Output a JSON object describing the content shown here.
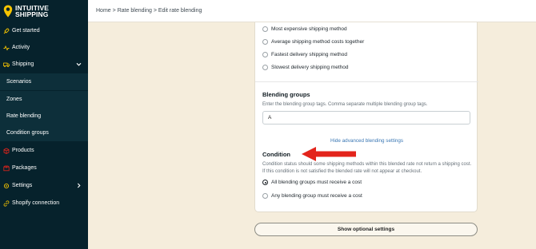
{
  "app": {
    "logo_line1": "INTUITIVE",
    "logo_line2": "SHIPPING",
    "brand_color": "#f5c400",
    "sidebar_bg": "#06222c",
    "accent_red": "#e3241b"
  },
  "breadcrumb": {
    "home": "Home",
    "sep1": ">",
    "rate_blending": "Rate blending",
    "sep2": ">",
    "current": "Edit rate blending"
  },
  "sidebar": {
    "items": [
      {
        "label": "Get started",
        "icon": "rocket-icon"
      },
      {
        "label": "Activity",
        "icon": "activity-icon"
      },
      {
        "label": "Shipping",
        "icon": "truck-icon",
        "expanded": true
      },
      {
        "label": "Scenarios"
      },
      {
        "label": "Zones"
      },
      {
        "label": "Rate blending"
      },
      {
        "label": "Condition groups"
      },
      {
        "label": "Products",
        "icon": "box-icon"
      },
      {
        "label": "Packages",
        "icon": "package-icon"
      },
      {
        "label": "Settings",
        "icon": "gear-icon"
      },
      {
        "label": "Shopify connection",
        "icon": "link-icon"
      }
    ]
  },
  "methods": {
    "options": [
      {
        "label": "Most expensive shipping method",
        "selected": false
      },
      {
        "label": "Average shipping method costs together",
        "selected": false
      },
      {
        "label": "Fastest delivery shipping method",
        "selected": false
      },
      {
        "label": "Slowest delivery shipping method",
        "selected": false
      }
    ]
  },
  "blending_groups": {
    "title": "Blending groups",
    "help": "Enter the blending group tags. Comma separate multiple blending group tags.",
    "value": "A"
  },
  "advanced_link": "Hide advanced blending settings",
  "condition": {
    "title": "Condition",
    "help": "Condition status should some shipping methods within this blended rate not return a shipping cost. If this condition is not satisfied the blended rate will not appear at checkout.",
    "options": [
      {
        "label": "All blending groups must receive a cost",
        "selected": true
      },
      {
        "label": "Any blending group must receive a cost",
        "selected": false
      }
    ]
  },
  "optional_settings_button": "Show optional settings"
}
